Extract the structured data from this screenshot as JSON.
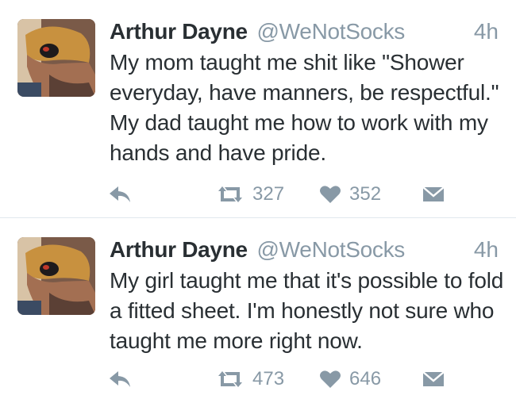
{
  "tweets": [
    {
      "name": "Arthur Dayne",
      "handle": "@WeNotSocks",
      "time": "4h",
      "text": "My mom taught me shit like \"Shower everyday, have manners, be respectful.\" My dad taught me how to work with my hands and have pride.",
      "retweets": "327",
      "likes": "352"
    },
    {
      "name": "Arthur Dayne",
      "handle": "@WeNotSocks",
      "time": "4h",
      "text": "My girl taught me that it's possible to fold a fitted sheet. I'm honestly not sure who taught me more right now.",
      "retweets": "473",
      "likes": "646"
    }
  ],
  "icons": {
    "reply": "reply-icon",
    "retweet": "retweet-icon",
    "like": "heart-icon",
    "message": "envelope-icon"
  },
  "colors": {
    "text": "#292f33",
    "muted": "#8899a6",
    "divider": "#e1e8ed"
  }
}
